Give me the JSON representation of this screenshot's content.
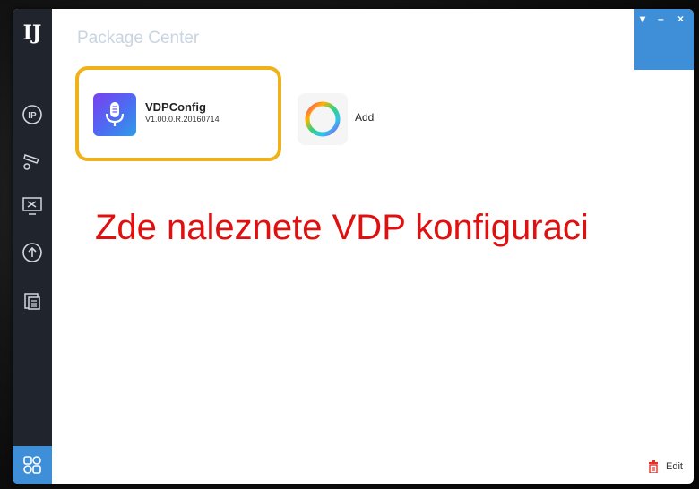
{
  "window": {
    "title": "Package Center",
    "controls": [
      "▾",
      "–",
      "×"
    ]
  },
  "sidebar": {
    "logo": "IJ",
    "items": [
      {
        "icon": "ip-icon"
      },
      {
        "icon": "camera-settings-icon"
      },
      {
        "icon": "tools-monitor-icon"
      },
      {
        "icon": "upgrade-icon"
      },
      {
        "icon": "copy-window-icon"
      }
    ],
    "bottom_icon": "package-grid-icon"
  },
  "apps": [
    {
      "name": "VDPConfig",
      "version": "V1.00.0.R.20160714",
      "icon": "microphone-icon"
    }
  ],
  "add": {
    "label": "Add",
    "icon": "ring-icon"
  },
  "annotation": {
    "text": "Zde naleznete VDP konfiguraci",
    "color": "#e01010"
  },
  "footer": {
    "edit_label": "Edit",
    "edit_icon": "trash-icon"
  },
  "colors": {
    "sidebar": "#20242c",
    "accent_blue": "#3f8fd8",
    "highlight_orange": "#f0b21b"
  }
}
